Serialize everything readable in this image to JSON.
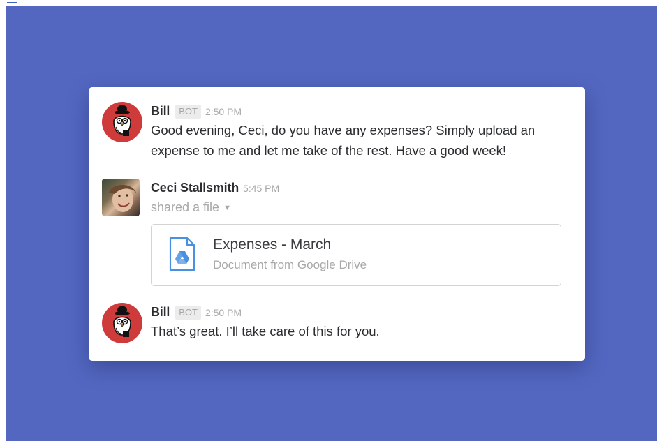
{
  "colors": {
    "background": "#5367c1",
    "card": "#ffffff",
    "text": "#2c2d30",
    "muted": "#a8a8a8",
    "bot_avatar": "#cf3b3b",
    "drive_blue": "#4a90e2"
  },
  "messages": [
    {
      "author": "Bill",
      "badge": "BOT",
      "time": "2:50 PM",
      "avatar_icon": "bot-bird-icon",
      "text": "Good evening, Ceci, do you have any expenses? Simply upload an expense to me and let me take of the rest. Have a good week!"
    },
    {
      "author": "Ceci Stallsmith",
      "time": "5:45 PM",
      "avatar_icon": "user-photo",
      "action": "shared a file",
      "file": {
        "icon": "google-drive-icon",
        "title": "Expenses - March",
        "subtitle": "Document from Google Drive"
      }
    },
    {
      "author": "Bill",
      "badge": "BOT",
      "time": "2:50 PM",
      "avatar_icon": "bot-bird-icon",
      "text": "That’s great. I’ll take care of this for you."
    }
  ]
}
